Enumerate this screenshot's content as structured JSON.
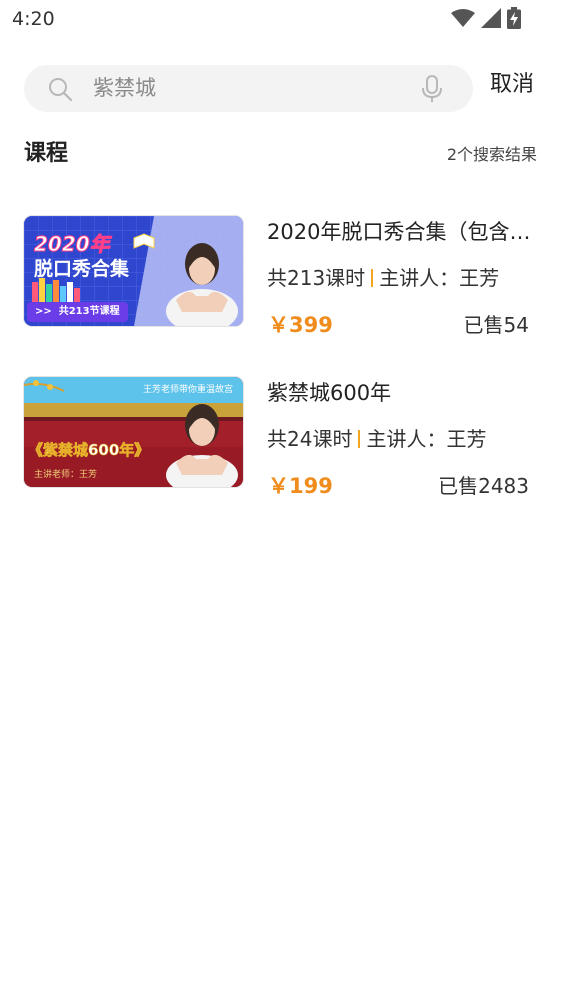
{
  "status_bar": {
    "time": "4:20",
    "icons": [
      "wifi-icon",
      "signal-icon",
      "battery-charging-icon"
    ]
  },
  "search": {
    "query": "紫禁城",
    "cancel_label": "取消",
    "icons": [
      "search-icon",
      "microphone-icon"
    ]
  },
  "section": {
    "title": "课程",
    "result_count": "2个搜索结果"
  },
  "courses": [
    {
      "title": "2020年脱口秀合集（包含…",
      "lessons": "共213课时",
      "lecturer": "主讲人：王芳",
      "price": "￥399",
      "sold": "已售54",
      "thumbnail": {
        "headline": "2020年",
        "subheadline": "脱口秀合集",
        "badge": ">>  共213节课程"
      }
    },
    {
      "title": "紫禁城600年",
      "lessons": "共24课时",
      "lecturer": "主讲人：王芳",
      "price": "￥199",
      "sold": "已售2483",
      "thumbnail": {
        "top_caption": "王芳老师带你重温故宫",
        "headline": "《紫禁城600年》",
        "teacher_caption": "主讲老师：王芳"
      }
    }
  ],
  "colors": {
    "price": "#f08c1c",
    "divider": "#f2a61f",
    "search_bg": "#f3f3f3"
  }
}
